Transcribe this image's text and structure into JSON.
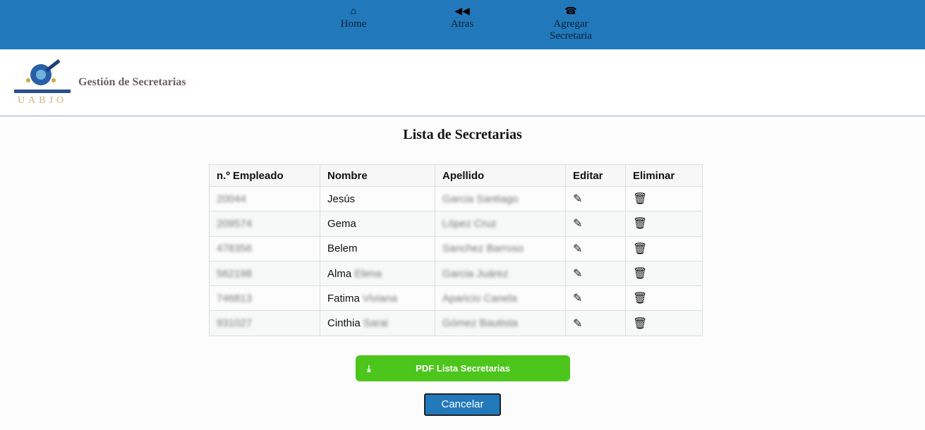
{
  "nav": [
    {
      "label": "Home",
      "icon": "home-icon"
    },
    {
      "label": "Atras",
      "icon": "rewind-icon"
    },
    {
      "label": "Agregar Secretaria",
      "icon": "add-person-icon"
    }
  ],
  "header": {
    "title": "Gestión de Secretarias",
    "logo_text": "UABJO"
  },
  "page_title": "Lista de Secretarias",
  "table": {
    "columns": [
      "n.º Empleado",
      "Nombre",
      "Apellido",
      "Editar",
      "Eliminar"
    ],
    "rows": [
      {
        "id": "20044",
        "first": "Jesús",
        "second": "",
        "last": "Garcia Santiago"
      },
      {
        "id": "209574",
        "first": "Gema",
        "second": "",
        "last": "López Cruz"
      },
      {
        "id": "478356",
        "first": "Belem",
        "second": "",
        "last": "Sanchez Barroso"
      },
      {
        "id": "562198",
        "first": "Alma",
        "second": "Elena",
        "last": "Garcia Juárez"
      },
      {
        "id": "746813",
        "first": "Fatima",
        "second": "Viviana",
        "last": "Aparicio Canela"
      },
      {
        "id": "931027",
        "first": "Cinthia",
        "second": "Sarai",
        "last": "Gómez Bautista"
      }
    ]
  },
  "buttons": {
    "pdf": "PDF Lista Secretarias",
    "cancel": "Cancelar"
  },
  "colors": {
    "topbar": "#2178bb",
    "pdf_button": "#4cc61b",
    "cancel_button": "#2178bb"
  }
}
